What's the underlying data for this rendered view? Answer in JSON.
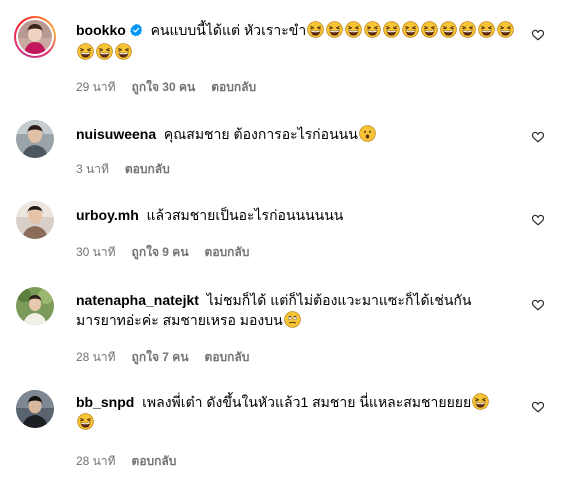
{
  "comments": [
    {
      "username": "bookko",
      "verified": true,
      "text": "คนแบบนี้ได้แต่ หัวเราะขำ",
      "emoji_count": 14,
      "time": "29 นาที",
      "likes": "ถูกใจ 30 คน",
      "reply": "ตอบกลับ"
    },
    {
      "username": "nuisuweena",
      "text": "คุณสมชาย ต้องการอะไรก่อนนน",
      "time": "3 นาที",
      "reply": "ตอบกลับ"
    },
    {
      "username": "urboy.mh",
      "text": "แล้วสมชายเป็นอะไรก่อนนนนนน",
      "time": "30 นาที",
      "likes": "ถูกใจ 9 คน",
      "reply": "ตอบกลับ"
    },
    {
      "username": "natenapha_natejkt",
      "text": "ไม่ชมก็ได้ แต่ก็ไม่ต้องแวะมาแซะก็ได้เช่นกัน",
      "text2": "มารยาทอ่ะค่ะ สมชายเหรอ มองบน",
      "time": "28 นาที",
      "likes": "ถูกใจ 7 คน",
      "reply": "ตอบกลับ"
    },
    {
      "username": "bb_snpd",
      "text": "เพลงพี่เต๋า ดังขึ้นในหัวแล้ว1 สมชาย นี่แหละสมชายยยย",
      "time": "28 นาที",
      "reply": "ตอบกลับ"
    }
  ],
  "icons": {
    "heart": "heart-outline-icon",
    "verified": "verified-badge-icon",
    "laugh": "grinning-squinting-face-emoji",
    "thinking": "face-with-open-mouth-emoji",
    "eyeroll": "face-with-rolling-eyes-emoji"
  },
  "colors": {
    "meta_text": "#737373",
    "verified_blue": "#0095f6"
  }
}
